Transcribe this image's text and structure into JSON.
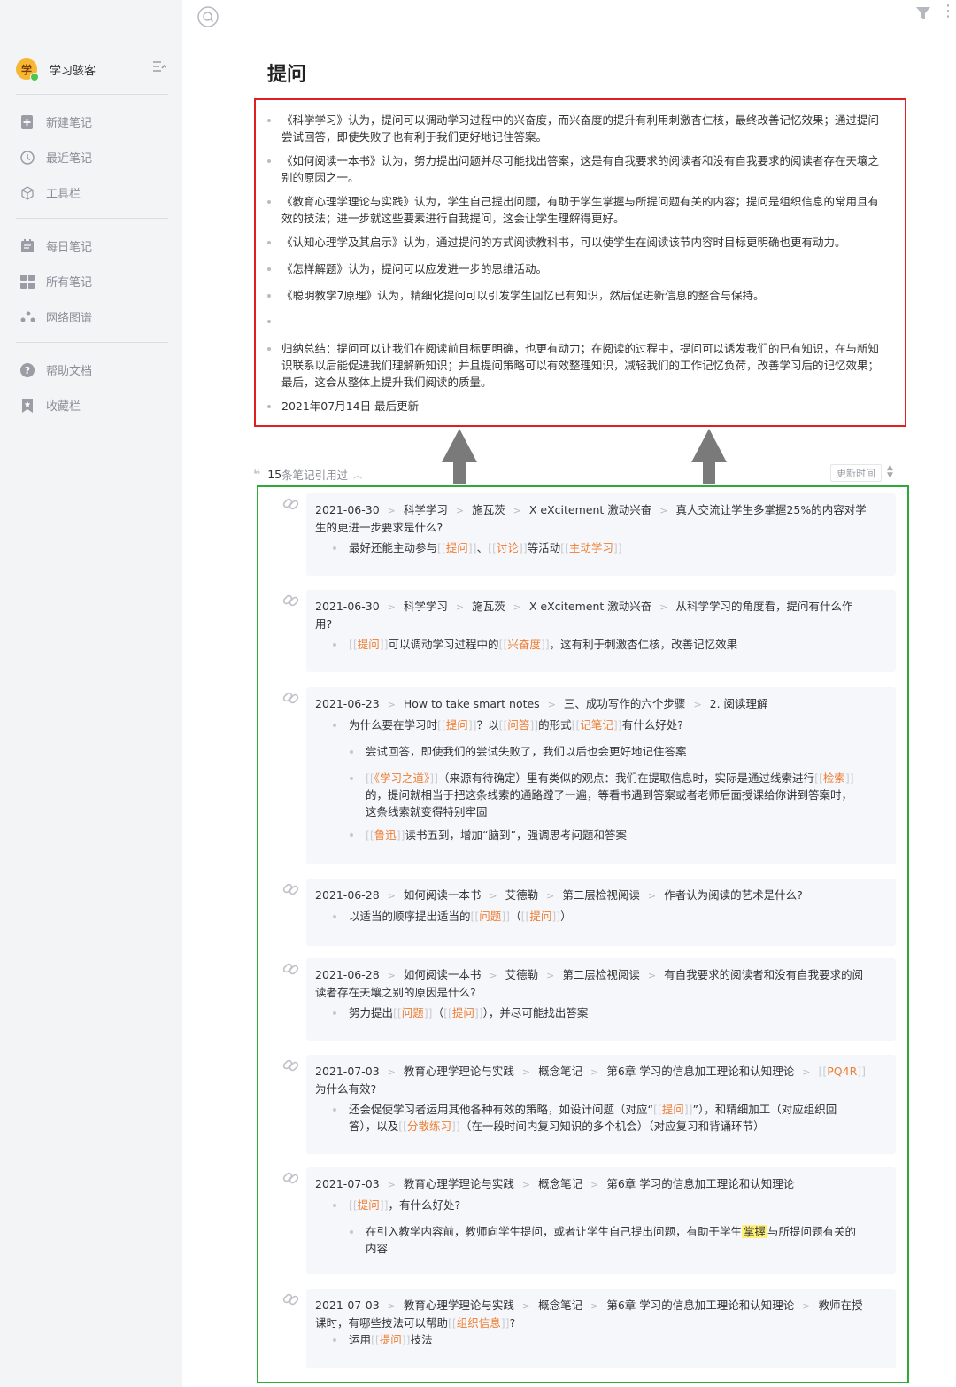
{
  "sidebar": {
    "user": {
      "avatar_text": "学",
      "name": "学习骇客"
    },
    "items": [
      {
        "key": "new",
        "label": "新建笔记",
        "icon": "new-note-icon"
      },
      {
        "key": "recent",
        "label": "最近笔记",
        "icon": "clock-icon"
      },
      {
        "key": "toolbar",
        "label": "工具栏",
        "icon": "cube-icon"
      },
      {
        "key": "daily",
        "label": "每日笔记",
        "icon": "calendar-icon"
      },
      {
        "key": "all",
        "label": "所有笔记",
        "icon": "grid-icon"
      },
      {
        "key": "graph",
        "label": "网络图谱",
        "icon": "graph-icon"
      },
      {
        "key": "help",
        "label": "帮助文档",
        "icon": "help-icon"
      },
      {
        "key": "favorites",
        "label": "收藏栏",
        "icon": "bookmark-icon"
      }
    ]
  },
  "page": {
    "title": "提问",
    "bullets": [
      "《科学学习》认为，提问可以调动学习过程中的兴奋度，而兴奋度的提升有利用刺激杏仁核，最终改善记忆效果；通过提问尝试回答，即使失败了也有利于我们更好地记住答案。",
      "《如何阅读一本书》认为，努力提出问题并尽可能找出答案，这是有自我要求的阅读者和没有自我要求的阅读者存在天壤之别的原因之一。",
      "《教育心理学理论与实践》认为，学生自己提出问题，有助于学生掌握与所提问题有关的内容；提问是组织信息的常用且有效的技法；进一步就这些要素进行自我提问，这会让学生理解得更好。",
      "《认知心理学及其启示》认为，通过提问的方式阅读教科书，可以使学生在阅读该节内容时目标更明确也更有动力。",
      "《怎样解题》认为，提问可以应发进一步的思维活动。",
      "《聪明教学7原理》认为，精细化提问可以引发学生回忆已有知识，然后促进新信息的整合与保持。",
      "",
      "归纳总结：提问可以让我们在阅读前目标更明确，也更有动力；在阅读的过程中，提问可以诱发我们的已有知识，在与新知识联系以后能促进我们理解新知识；并且提问策略可以有效整理知识，减轻我们的工作记忆负荷，改善学习后的记忆效果；最后，这会从整体上提升我们阅读的质量。",
      "2021年07月14日 最后更新"
    ]
  },
  "references": {
    "count": "15",
    "count_suffix": "条笔记引用过",
    "sort_label": "更新时间",
    "cards": [
      {
        "crumbs": [
          "2021-06-30",
          "科学学习",
          "施瓦茨",
          "X eXcitement 激动兴奋",
          "真人交流让学生多掌握25%的内容对学生的更进一步要求是什么?"
        ],
        "subs": [
          {
            "level": 1,
            "parts": [
              {
                "t": "最好还能主动参与"
              },
              {
                "tag": "提问"
              },
              {
                "t": "、"
              },
              {
                "tag": "讨论"
              },
              {
                "t": "等活动"
              },
              {
                "tag": "主动学习"
              }
            ]
          }
        ]
      },
      {
        "crumbs": [
          "2021-06-30",
          "科学学习",
          "施瓦茨",
          "X eXcitement 激动兴奋",
          "从科学学习的角度看，提问有什么作用?"
        ],
        "subs": [
          {
            "level": 1,
            "parts": [
              {
                "tag": "提问"
              },
              {
                "t": "可以调动学习过程中的"
              },
              {
                "tag": "兴奋度"
              },
              {
                "t": "，这有利于刺激杏仁核，改善记忆效果"
              }
            ]
          }
        ]
      },
      {
        "crumbs": [
          "2021-06-23",
          "How to take smart notes",
          "三、成功写作的六个步骤",
          "2. 阅读理解"
        ],
        "subs": [
          {
            "level": 1,
            "parts": [
              {
                "t": "为什么要在学习时"
              },
              {
                "tag": "提问"
              },
              {
                "t": "？以"
              },
              {
                "tag": "问答"
              },
              {
                "t": "的形式"
              },
              {
                "tag": "记笔记"
              },
              {
                "t": "有什么好处?"
              }
            ]
          },
          {
            "level": 2,
            "parts": [
              {
                "t": "尝试回答，即使我们的尝试失败了，我们以后也会更好地记住答案"
              }
            ]
          },
          {
            "level": 2,
            "parts": [
              {
                "tag": "《学习之道》"
              },
              {
                "t": "（来源有待确定）里有类似的观点：我们在提取信息时，实际是通过线索进行"
              },
              {
                "tag": "检索"
              },
              {
                "t": "的，提问就相当于把这条线索的通路蹚了一遍，等看书遇到答案或者老师后面授课给你讲到答案时，这条线索就变得特别牢固"
              }
            ]
          },
          {
            "level": 2,
            "parts": [
              {
                "tag": "鲁迅"
              },
              {
                "t": "读书五到，增加“脑到”，强调思考问题和答案"
              }
            ]
          }
        ]
      },
      {
        "crumbs": [
          "2021-06-28",
          "如何阅读一本书",
          "艾德勒",
          "第二层检视阅读",
          "作者认为阅读的艺术是什么?"
        ],
        "subs": [
          {
            "level": 1,
            "parts": [
              {
                "t": "以适当的顺序提出适当的"
              },
              {
                "tag": "问题"
              },
              {
                "t": "（"
              },
              {
                "tag": "提问"
              },
              {
                "t": "）"
              }
            ]
          }
        ]
      },
      {
        "crumbs": [
          "2021-06-28",
          "如何阅读一本书",
          "艾德勒",
          "第二层检视阅读",
          "有自我要求的阅读者和没有自我要求的阅读者存在天壤之别的原因是什么?"
        ],
        "subs": [
          {
            "level": 1,
            "parts": [
              {
                "t": "努力提出"
              },
              {
                "tag": "问题"
              },
              {
                "t": "（"
              },
              {
                "tag": "提问"
              },
              {
                "t": "），并尽可能找出答案"
              }
            ]
          }
        ]
      },
      {
        "crumbs": [
          "2021-07-03",
          "教育心理学理论与实践",
          "概念笔记",
          "第6章 学习的信息加工理论和认知理论",
          "[[PQ4R]] 为什么有效?"
        ],
        "subs": [
          {
            "level": 1,
            "parts": [
              {
                "t": "还会促使学习者运用其他各种有效的策略，如设计问题（对应“"
              },
              {
                "tag": "提问"
              },
              {
                "t": "”），和精细加工（对应组织回答），以及"
              },
              {
                "tag": "分散练习"
              },
              {
                "t": "（在一段时间内复习知识的多个机会）（对应复习和背诵环节）"
              }
            ]
          }
        ]
      },
      {
        "crumbs": [
          "2021-07-03",
          "教育心理学理论与实践",
          "概念笔记",
          "第6章 学习的信息加工理论和认知理论"
        ],
        "subs": [
          {
            "level": 1,
            "parts": [
              {
                "tag": "提问"
              },
              {
                "t": "，有什么好处?"
              }
            ]
          },
          {
            "level": 2,
            "parts": [
              {
                "t": "在引入教学内容前，教师向学生提问，或者让学生自己提出问题，有助于学生"
              },
              {
                "hl": "掌握"
              },
              {
                "t": "与所提问题有关的内容"
              }
            ]
          }
        ]
      },
      {
        "crumbs": [
          "2021-07-03",
          "教育心理学理论与实践",
          "概念笔记",
          "第6章 学习的信息加工理论和认知理论",
          "教师在授课时，有哪些技法可以帮助[[组织信息]]?"
        ],
        "subs": [
          {
            "level": 1,
            "parts": [
              {
                "t": "运用"
              },
              {
                "tag": "提问"
              },
              {
                "t": "技法"
              }
            ]
          }
        ]
      }
    ]
  }
}
